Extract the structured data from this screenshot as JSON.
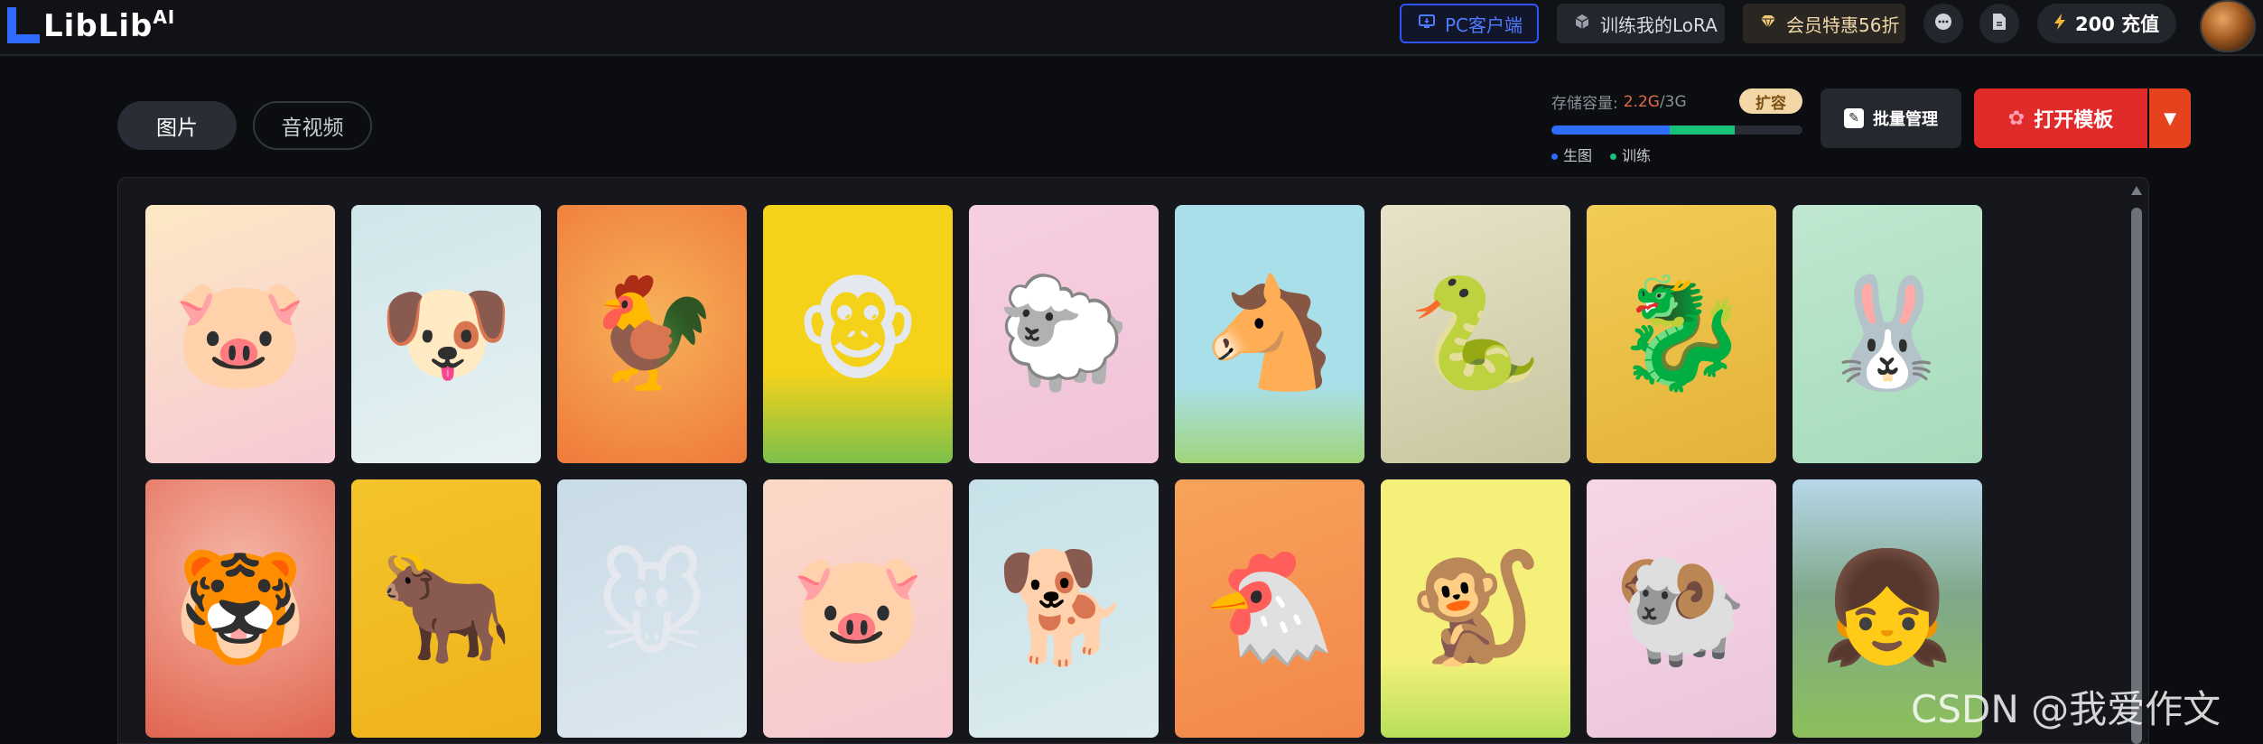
{
  "brand": {
    "name": "LibLib",
    "suffix": "AI"
  },
  "nav": {
    "pc_client": "PC客户端",
    "train_lora": "训练我的LoRA",
    "vip": "会员特惠56折",
    "charge": "200 充值"
  },
  "tabs": {
    "images": "图片",
    "audio_video": "音视频"
  },
  "storage": {
    "label": "存储容量:",
    "used": "2.2G",
    "total": "/3G",
    "expand": "扩容",
    "gen_fraction": 0.47,
    "train_fraction": 0.26,
    "legend_gen": "生图",
    "legend_train": "训练",
    "color_gen": "#2e6bff",
    "color_train": "#18c27a"
  },
  "actions": {
    "batch_manage": "批量管理",
    "open_template": "打开模板"
  },
  "gallery": {
    "row1": [
      {
        "name": "pig",
        "glyph": "🐷",
        "bg": "linear-gradient(160deg,#fce9c4,#f7c9d4)"
      },
      {
        "name": "dog",
        "glyph": "🐶",
        "bg": "linear-gradient(160deg,#cfe6ea,#e7f1f2)"
      },
      {
        "name": "rooster",
        "glyph": "🐓",
        "bg": "radial-gradient(circle at 50% 45%,#f7b25a,#ef7a3a)"
      },
      {
        "name": "monkey",
        "glyph": "🐵",
        "bg": "linear-gradient(180deg,#f4d21a 65%,#7cc04a 100%)"
      },
      {
        "name": "sheep",
        "glyph": "🐑",
        "bg": "linear-gradient(160deg,#f5cfe0,#f2c3d8)"
      },
      {
        "name": "horse",
        "glyph": "🐴",
        "bg": "linear-gradient(180deg,#a9dfe9 70%,#9fd47a 100%)"
      },
      {
        "name": "snake",
        "glyph": "🐍",
        "bg": "linear-gradient(160deg,#e8e3c8,#c7c59f)"
      },
      {
        "name": "dragon",
        "glyph": "🐉",
        "bg": "linear-gradient(160deg,#f1cc57,#e4b238)"
      },
      {
        "name": "rabbit",
        "glyph": "🐰",
        "bg": "linear-gradient(160deg,#bfe7cf,#a6dcbb)"
      }
    ],
    "row2": [
      {
        "name": "tiger",
        "glyph": "🐯",
        "bg": "radial-gradient(circle at 50% 35%,#f6b6a6,#e06550)"
      },
      {
        "name": "ox",
        "glyph": "🐂",
        "bg": "linear-gradient(160deg,#f4c42a,#f0b21b)"
      },
      {
        "name": "rat",
        "glyph": "🐭",
        "bg": "linear-gradient(160deg,#c9dbe7,#dde8ef)"
      },
      {
        "name": "pig-2",
        "glyph": "🐷",
        "bg": "linear-gradient(160deg,#fbd9c6,#f6c8d1)"
      },
      {
        "name": "dog-2",
        "glyph": "🐕",
        "bg": "linear-gradient(160deg,#c6e2e8,#dcecef)"
      },
      {
        "name": "rooster-2",
        "glyph": "🐔",
        "bg": "linear-gradient(160deg,#f7a35a,#f3864a)"
      },
      {
        "name": "monkey-2",
        "glyph": "🐒",
        "bg": "linear-gradient(180deg,#f4f07a 70%,#b7e05a 100%)"
      },
      {
        "name": "sheep-2",
        "glyph": "🐏",
        "bg": "linear-gradient(160deg,#f6d6e6,#ecc6dc)"
      },
      {
        "name": "girl-with-dog",
        "glyph": "👧",
        "bg": "linear-gradient(180deg,#b8d7ea 0%,#7fa88a 45%,#8cbf5a 100%)"
      }
    ]
  },
  "watermark": "CSDN @我爱作文"
}
